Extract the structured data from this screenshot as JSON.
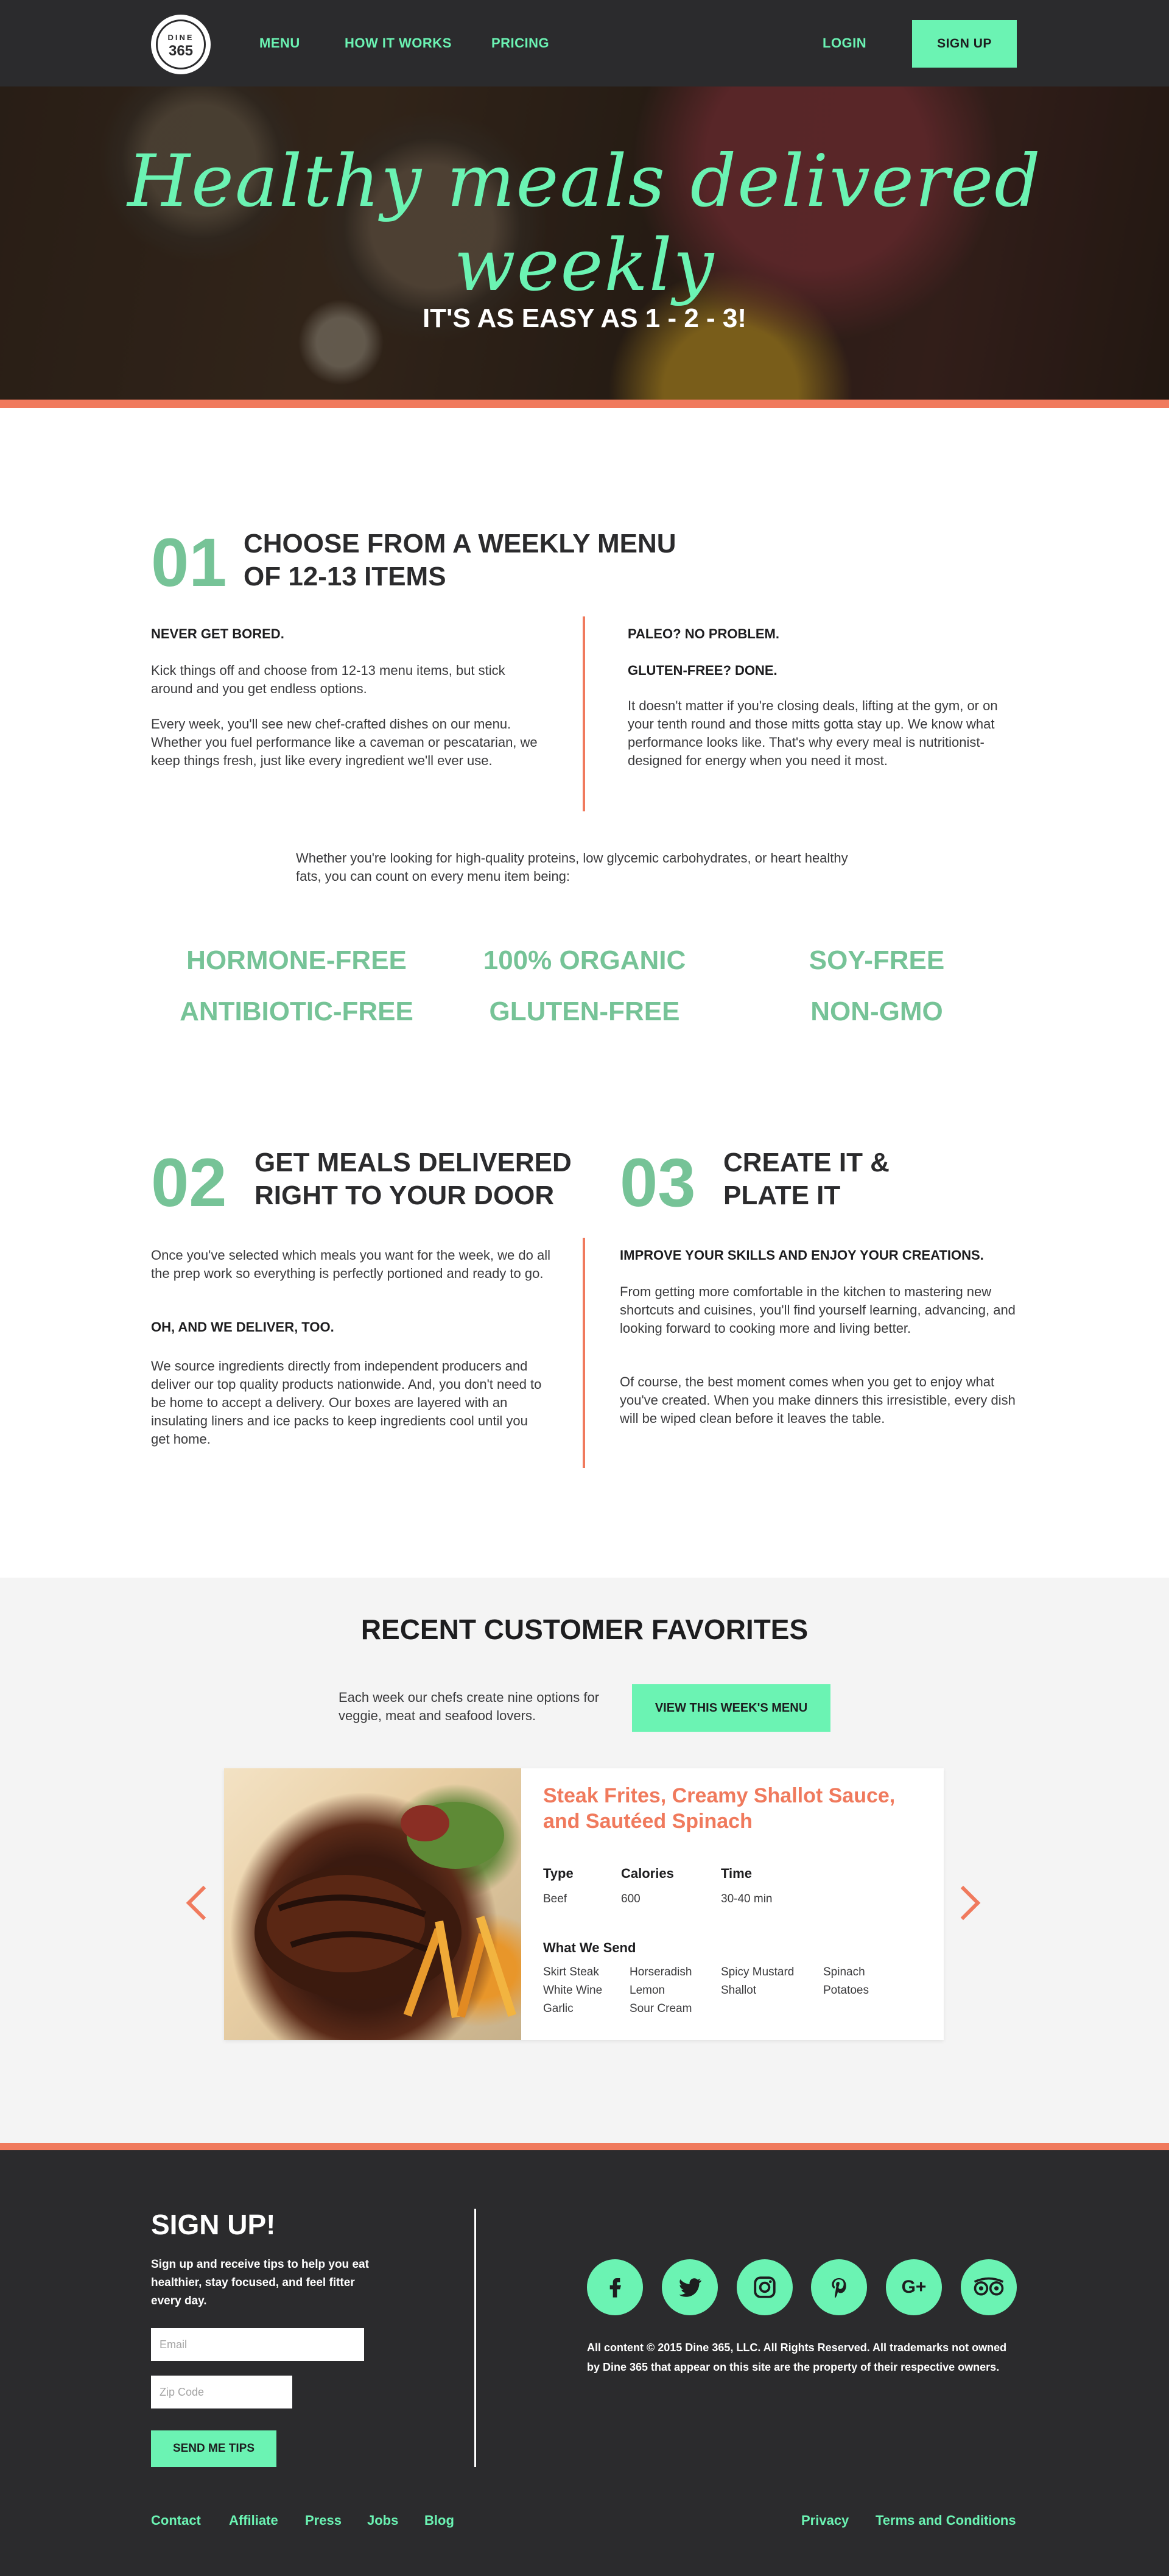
{
  "nav": {
    "logo_top": "DINE",
    "logo_bottom": "365",
    "links": [
      "MENU",
      "HOW IT WORKS",
      "PRICING"
    ],
    "login": "LOGIN",
    "signup": "SIGN UP"
  },
  "hero": {
    "title": "Healthy meals delivered weekly",
    "subtitle": "IT'S AS EASY AS 1 - 2 - 3!"
  },
  "step1": {
    "number": "01",
    "title_line1": "CHOOSE FROM A WEEKLY MENU",
    "title_line2": "OF 12-13 ITEMS",
    "left_heading": "NEVER GET BORED.",
    "left_p1": "Kick things off and choose from 12-13 menu items, but stick around and you get endless options.",
    "left_p2": "Every week, you'll see new chef-crafted dishes on our menu. Whether you fuel performance like a caveman or pescatarian, we keep things fresh, just like every ingredient we'll ever use.",
    "right_heading1": "PALEO? NO PROBLEM.",
    "right_heading2": "GLUTEN-FREE? DONE.",
    "right_p1": "It doesn't matter if you're closing deals, lifting at the gym, or on your tenth round and those mitts gotta stay up. We know what performance looks like. That's why every meal is nutritionist-designed for energy when you need it most."
  },
  "intro_attributes": "Whether you're looking for high-quality proteins, low glycemic carbohydrates, or heart healthy fats, you can count on every menu item being:",
  "attributes": [
    "HORMONE-FREE",
    "100% ORGANIC",
    "SOY-FREE",
    "ANTIBIOTIC-FREE",
    "GLUTEN-FREE",
    "NON-GMO"
  ],
  "step2": {
    "number": "02",
    "title_line1": "GET MEALS DELIVERED",
    "title_line2": "RIGHT TO YOUR DOOR",
    "p1": "Once you've selected which meals you want for the week, we do all the prep work so everything is perfectly portioned and ready to go.",
    "heading": "OH, AND WE DELIVER, TOO.",
    "p2": "We source ingredients directly from independent producers and deliver our top quality products nationwide. And, you don't need to be home to accept a delivery. Our boxes are layered with an insulating liners and ice packs to keep ingredients cool until you get home."
  },
  "step3": {
    "number": "03",
    "title_line1": "CREATE IT &",
    "title_line2": "PLATE IT",
    "heading": "IMPROVE YOUR SKILLS AND ENJOY YOUR CREATIONS.",
    "p1": "From getting more comfortable in the kitchen to mastering new shortcuts and cuisines, you'll find yourself learning, advancing, and looking forward to cooking more and living better.",
    "p2": "Of course, the best moment comes when you get to enjoy what you've created. When you make dinners this irresistible, every dish will be wiped clean before it leaves the table."
  },
  "favorites": {
    "title": "RECENT CUSTOMER FAVORITES",
    "description": "Each week our chefs create nine options for veggie, meat and seafood lovers.",
    "button": "VIEW THIS WEEK'S MENU",
    "card": {
      "name": "Steak Frites, Creamy Shallot Sauce, and Sautéed Spinach",
      "type_label": "Type",
      "type_value": "Beef",
      "calories_label": "Calories",
      "calories_value": "600",
      "time_label": "Time",
      "time_value": "30-40 min",
      "send_label": "What We Send",
      "ingredients": [
        "Skirt Steak",
        "Horseradish",
        "Spicy Mustard",
        "Spinach",
        "White Wine",
        "Lemon",
        "Shallot",
        "Potatoes",
        "Garlic",
        "Sour Cream"
      ]
    }
  },
  "footer": {
    "title": "SIGN UP!",
    "text": "Sign up and receive tips to help you eat healthier, stay focused, and feel fitter every day.",
    "email_placeholder": "Email",
    "zip_placeholder": "Zip Code",
    "button": "SEND ME TIPS",
    "social": [
      "facebook-icon",
      "twitter-icon",
      "instagram-icon",
      "pinterest-icon",
      "google-plus-icon",
      "tripadvisor-icon"
    ],
    "legal": "All content © 2015 Dine 365, LLC. All Rights Reserved. All trademarks not owned by Dine 365 that appear on this site are the property of their respective owners.",
    "links_left": [
      "Contact",
      "Affiliate",
      "Press",
      "Jobs",
      "Blog"
    ],
    "links_right": [
      "Privacy",
      "Terms and Conditions"
    ]
  },
  "colors": {
    "mint": "#6bf3b3",
    "green": "#76c397",
    "coral": "#f07a5d",
    "dark": "#2b2b2d"
  }
}
